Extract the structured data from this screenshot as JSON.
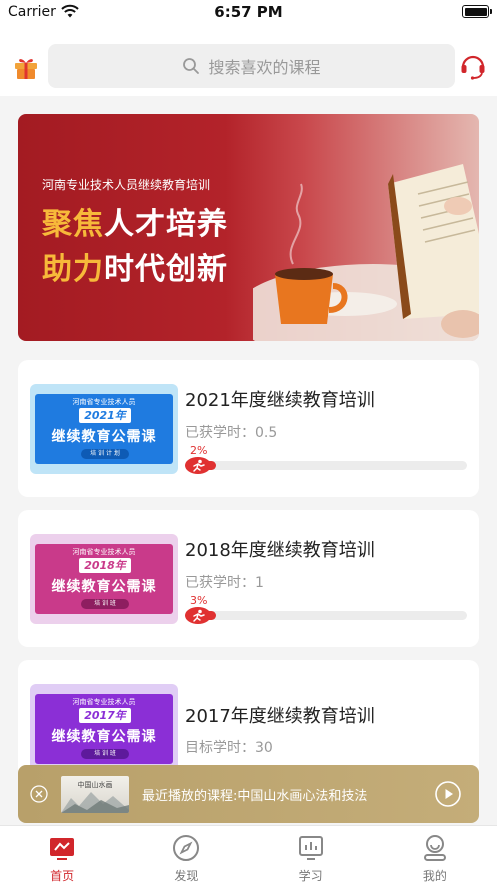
{
  "status_bar": {
    "carrier": "Carrier",
    "time": "6:57 PM"
  },
  "header": {
    "search_placeholder": "搜索喜欢的课程"
  },
  "banner": {
    "subtitle": "河南专业技术人员继续教育培训",
    "line1_highlight": "聚焦",
    "line1_rest": "人才培养",
    "line2_highlight": "助力",
    "line2_rest": "时代创新"
  },
  "courses": [
    {
      "title": "2021年度继续教育培训",
      "meta": "已获学时：0.5",
      "progress_label": "2%",
      "progress": 0.02,
      "thumb": {
        "tag": "河南省专业技术人员",
        "year": "2021年",
        "title": "继续教育公需课",
        "sub": "培 训 计 划",
        "color": "#1f7be0"
      }
    },
    {
      "title": "2018年度继续教育培训",
      "meta": "已获学时：1",
      "progress_label": "3%",
      "progress": 0.03,
      "thumb": {
        "tag": "河南省专业技术人员",
        "year": "2018年",
        "title": "继续教育公需课",
        "sub": "培 训 班",
        "color": "#c93a8a"
      }
    },
    {
      "title": "2017年度继续教育培训",
      "meta": "目标学时：30",
      "thumb": {
        "tag": "河南省专业技术人员",
        "year": "2017年",
        "title": "继续教育公需课",
        "sub": "培 训 班",
        "color": "#8b2fd6"
      }
    }
  ],
  "mini_player": {
    "text": "最近播放的课程:中国山水画心法和技法",
    "thumb_label": "中国山水画"
  },
  "tabs": [
    {
      "label": "首页",
      "icon": "home-icon",
      "active": true
    },
    {
      "label": "发现",
      "icon": "compass-icon",
      "active": false
    },
    {
      "label": "学习",
      "icon": "study-icon",
      "active": false
    },
    {
      "label": "我的",
      "icon": "profile-icon",
      "active": false
    }
  ],
  "colors": {
    "accent": "#d1262b",
    "banner_red": "#a31b22",
    "player_gold": "#b8a06a"
  }
}
